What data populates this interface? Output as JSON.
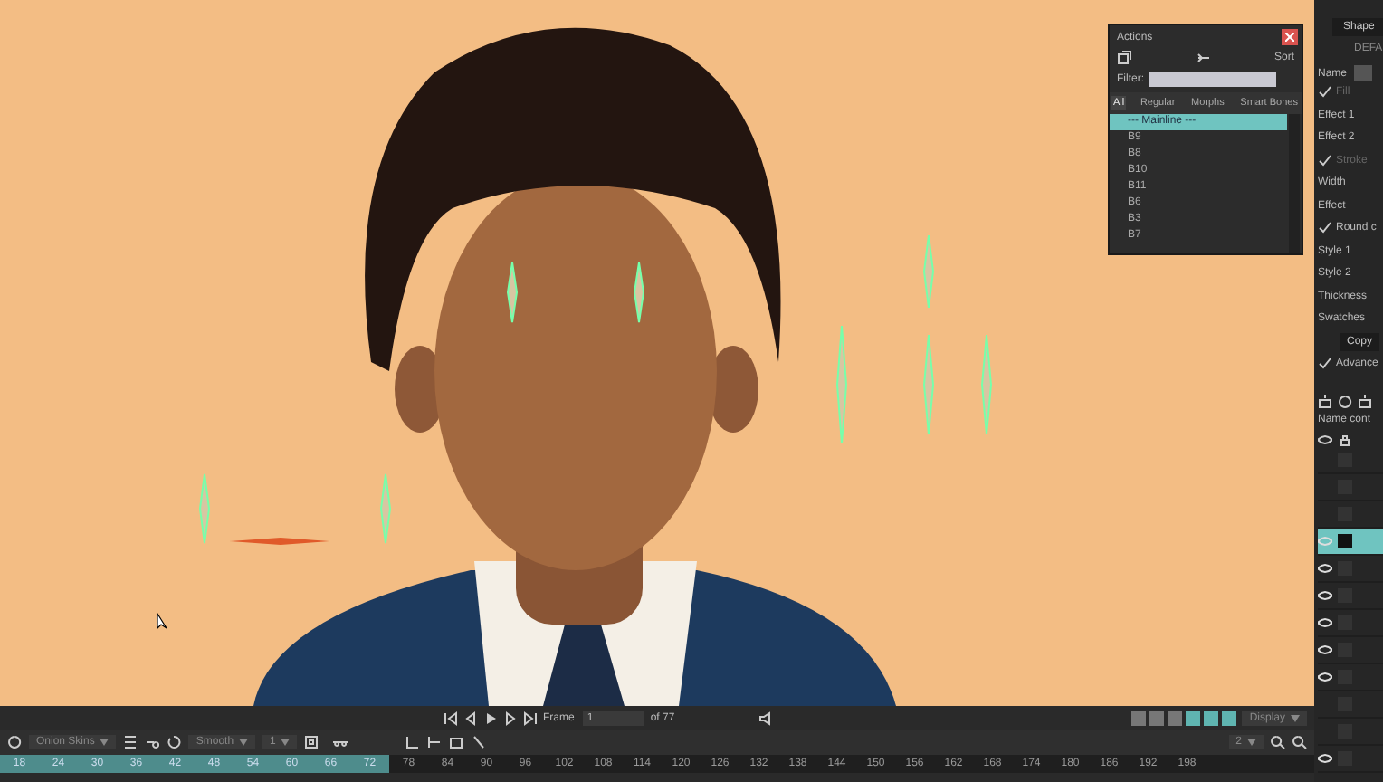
{
  "actions_panel": {
    "title": "Actions",
    "sort": "Sort",
    "filter_label": "Filter:",
    "tabs": [
      {
        "label": "All",
        "selected": true
      },
      {
        "label": "Regular",
        "selected": false
      },
      {
        "label": "Morphs",
        "selected": false
      },
      {
        "label": "Smart Bones",
        "selected": false
      }
    ],
    "items": [
      {
        "label": "--- Mainline ---",
        "selected": true
      },
      {
        "label": "B9",
        "selected": false
      },
      {
        "label": "B8",
        "selected": false
      },
      {
        "label": "B10",
        "selected": false
      },
      {
        "label": "B11",
        "selected": false
      },
      {
        "label": "B6",
        "selected": false
      },
      {
        "label": "B3",
        "selected": false
      },
      {
        "label": "B7",
        "selected": false
      }
    ]
  },
  "properties_panel": {
    "header": "Shape",
    "preset": "DEFA",
    "name_label": "Name",
    "rows": [
      {
        "kind": "section",
        "label": "Fill",
        "checked": true
      },
      {
        "kind": "label",
        "label": "Effect 1"
      },
      {
        "kind": "label",
        "label": "Effect 2"
      },
      {
        "kind": "section",
        "label": "Stroke",
        "checked": true
      },
      {
        "kind": "label",
        "label": "Width"
      },
      {
        "kind": "label",
        "label": "Effect"
      },
      {
        "kind": "check",
        "label": "Round c",
        "checked": true
      },
      {
        "kind": "label",
        "label": "Style 1"
      },
      {
        "kind": "label",
        "label": "Style 2"
      },
      {
        "kind": "label",
        "label": "Thickness"
      },
      {
        "kind": "label",
        "label": "Swatches"
      },
      {
        "kind": "button",
        "label": "Copy"
      },
      {
        "kind": "check",
        "label": "Advance",
        "checked": true
      }
    ]
  },
  "layers_panel": {
    "header": "Name cont",
    "layers": [
      {
        "visible": false,
        "selected": false
      },
      {
        "visible": false,
        "selected": false
      },
      {
        "visible": false,
        "selected": false
      },
      {
        "visible": true,
        "selected": true
      },
      {
        "visible": true,
        "selected": false
      },
      {
        "visible": true,
        "selected": false
      },
      {
        "visible": true,
        "selected": false
      },
      {
        "visible": true,
        "selected": false
      },
      {
        "visible": true,
        "selected": false
      },
      {
        "visible": false,
        "selected": false
      },
      {
        "visible": false,
        "selected": false
      },
      {
        "visible": true,
        "selected": false
      }
    ]
  },
  "transport": {
    "frame_label": "Frame",
    "frame_value": "1",
    "total": "of 77"
  },
  "toolbar": {
    "onion": "Onion Skins",
    "interpolation": "Smooth",
    "value": "1",
    "zoom_value": "2",
    "display": "Display"
  },
  "ruler": [
    {
      "label": "18",
      "highlighted": true
    },
    {
      "label": "24",
      "highlighted": true
    },
    {
      "label": "30",
      "highlighted": true
    },
    {
      "label": "36",
      "highlighted": true
    },
    {
      "label": "42",
      "highlighted": true
    },
    {
      "label": "48",
      "highlighted": true
    },
    {
      "label": "54",
      "highlighted": true
    },
    {
      "label": "60",
      "highlighted": true
    },
    {
      "label": "66",
      "highlighted": true
    },
    {
      "label": "72",
      "highlighted": true
    },
    {
      "label": "78",
      "highlighted": false
    },
    {
      "label": "84",
      "highlighted": false
    },
    {
      "label": "90",
      "highlighted": false
    },
    {
      "label": "96",
      "highlighted": false
    },
    {
      "label": "102",
      "highlighted": false
    },
    {
      "label": "108",
      "highlighted": false
    },
    {
      "label": "114",
      "highlighted": false
    },
    {
      "label": "120",
      "highlighted": false
    },
    {
      "label": "126",
      "highlighted": false
    },
    {
      "label": "132",
      "highlighted": false
    },
    {
      "label": "138",
      "highlighted": false
    },
    {
      "label": "144",
      "highlighted": false
    },
    {
      "label": "150",
      "highlighted": false
    },
    {
      "label": "156",
      "highlighted": false
    },
    {
      "label": "162",
      "highlighted": false
    },
    {
      "label": "168",
      "highlighted": false
    },
    {
      "label": "174",
      "highlighted": false
    },
    {
      "label": "180",
      "highlighted": false
    },
    {
      "label": "186",
      "highlighted": false
    },
    {
      "label": "192",
      "highlighted": false
    },
    {
      "label": "198",
      "highlighted": false
    }
  ]
}
